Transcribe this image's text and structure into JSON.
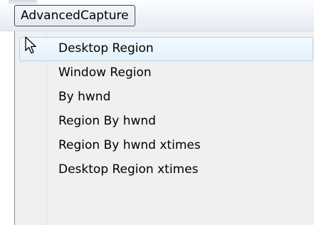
{
  "menubar": {
    "title": "AdvancedCapture"
  },
  "menu": {
    "items": [
      {
        "label": "Desktop Region",
        "highlighted": true
      },
      {
        "label": "Window Region"
      },
      {
        "label": "By hwnd"
      },
      {
        "label": "Region By hwnd"
      },
      {
        "label": "Region By hwnd xtimes"
      },
      {
        "label": "Desktop Region xtimes"
      }
    ]
  },
  "colors": {
    "highlight_border": "#a9d5f5",
    "highlight_fill": "#e5f2fc",
    "menu_background": "#f0f0f0"
  },
  "icons": {
    "pointer": "mouse-pointer-icon"
  }
}
